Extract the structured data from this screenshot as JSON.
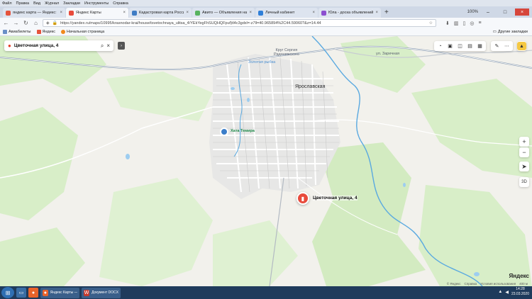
{
  "menubar": [
    "Файл",
    "Правка",
    "Вид",
    "Журнал",
    "Закладки",
    "Инструменты",
    "Справка"
  ],
  "tabs": [
    {
      "title": "яндекс карта — Яндекс: нашл",
      "color": "#e5533c",
      "active": false
    },
    {
      "title": "Яндекс Карты",
      "color": "#e84b3c",
      "active": true
    },
    {
      "title": "Кадастровая карта России он",
      "color": "#3f7cc4",
      "active": false
    },
    {
      "title": "Авито — Объявления на сайт",
      "color": "#57b35f",
      "active": false
    },
    {
      "title": "Личный кабинет",
      "color": "#2f7fd8",
      "active": false
    },
    {
      "title": "Юла - доска объявлений в К",
      "color": "#8c4fd0",
      "active": false
    }
  ],
  "window": {
    "zoom": "100%"
  },
  "address": {
    "url": "https://yandex.ru/maps/10995/krasnodar-krai/house/tsvetochnaya_ulitsa_4/YEkYegFhSUQHQFpuf)tl4c3gdxl=-z7ll=40.965894%2C44.59060?&z=14.44"
  },
  "bookmarks": {
    "items": [
      "Авиабилеты",
      "Яндекс",
      "Начальная страница"
    ],
    "other": "Другие закладки"
  },
  "search": {
    "query": "Цветочная улица, 4"
  },
  "map": {
    "labels": {
      "krug": "Круг Сергия\nРадонежского",
      "zolotaya": "Золотая рыбка",
      "yaroslavskaya": "Ярославская",
      "zarechnaya": "ул. Заречная",
      "marker_label": "Цветочная улица, 4",
      "poi": "Хата Темира"
    },
    "zoom_3d": "3D",
    "logo": "Яндекс",
    "scale": "400 м",
    "copyright": [
      "© Яндекс",
      "Справка",
      "Условия использования"
    ]
  },
  "taskbar": {
    "items": [
      "Яндекс Карты — ...",
      "Документ DOCX..."
    ],
    "time": "14:28",
    "date": "23.03.2020"
  }
}
